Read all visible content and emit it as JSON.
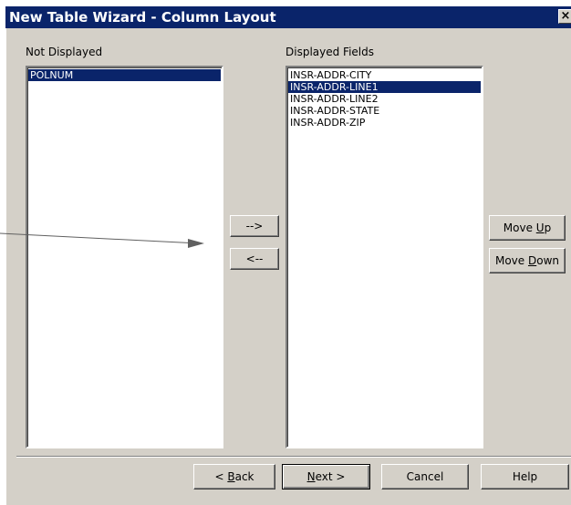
{
  "window": {
    "title": "New Table Wizard - Column Layout",
    "close_glyph": "×"
  },
  "not_displayed": {
    "label": "Not Displayed",
    "items": [
      {
        "text": "POLNUM",
        "selected": true
      }
    ]
  },
  "displayed": {
    "label": "Displayed Fields",
    "items": [
      {
        "text": "INSR-ADDR-CITY",
        "selected": false
      },
      {
        "text": "INSR-ADDR-LINE1",
        "selected": true
      },
      {
        "text": "INSR-ADDR-LINE2",
        "selected": false
      },
      {
        "text": "INSR-ADDR-STATE",
        "selected": false
      },
      {
        "text": "INSR-ADDR-ZIP",
        "selected": false
      }
    ]
  },
  "transfer": {
    "add_label": "-->",
    "remove_label": "<--"
  },
  "order": {
    "up_pre": "Move ",
    "up_key": "U",
    "up_post": "p",
    "down_pre": "Move ",
    "down_key": "D",
    "down_post": "own"
  },
  "footer": {
    "back_pre": "< ",
    "back_key": "B",
    "back_post": "ack",
    "next_key": "N",
    "next_post": "ext >",
    "cancel_label": "Cancel",
    "help_label": "Help"
  },
  "colors": {
    "selection": "#0a246a",
    "face": "#d4d0c8",
    "titlebar": "#0a246a"
  }
}
